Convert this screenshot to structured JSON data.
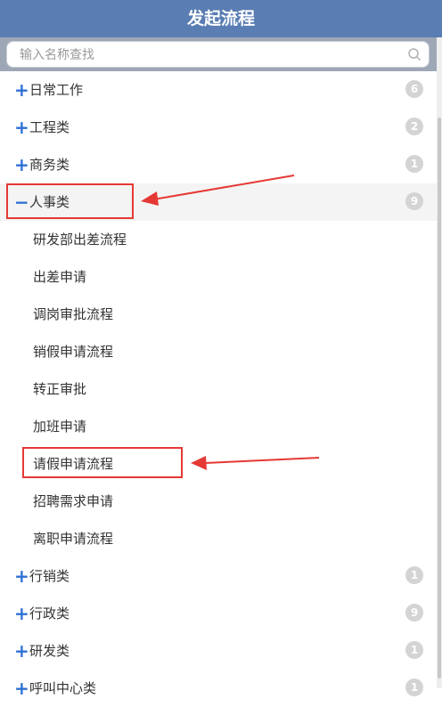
{
  "header": {
    "title": "发起流程"
  },
  "search": {
    "placeholder": "输入名称查找",
    "icon": "search-icon"
  },
  "categories": [
    {
      "sign": "+",
      "label": "日常工作",
      "count": "6",
      "expanded": false
    },
    {
      "sign": "+",
      "label": "工程类",
      "count": "2",
      "expanded": false
    },
    {
      "sign": "+",
      "label": "商务类",
      "count": "1",
      "expanded": false
    },
    {
      "sign": "−",
      "label": "人事类",
      "count": "9",
      "expanded": true
    }
  ],
  "subitems": [
    "研发部出差流程",
    "出差申请",
    "调岗审批流程",
    "销假申请流程",
    "转正审批",
    "加班申请",
    "请假申请流程",
    "招聘需求申请",
    "离职申请流程"
  ],
  "categories_after": [
    {
      "sign": "+",
      "label": "行销类",
      "count": "1"
    },
    {
      "sign": "+",
      "label": "行政类",
      "count": "9"
    },
    {
      "sign": "+",
      "label": "研发类",
      "count": "1"
    },
    {
      "sign": "+",
      "label": "呼叫中心类",
      "count": "1"
    }
  ],
  "annotation_color": "#e53935",
  "accent_color": "#2e6fd3",
  "header_color": "#5a7db3"
}
